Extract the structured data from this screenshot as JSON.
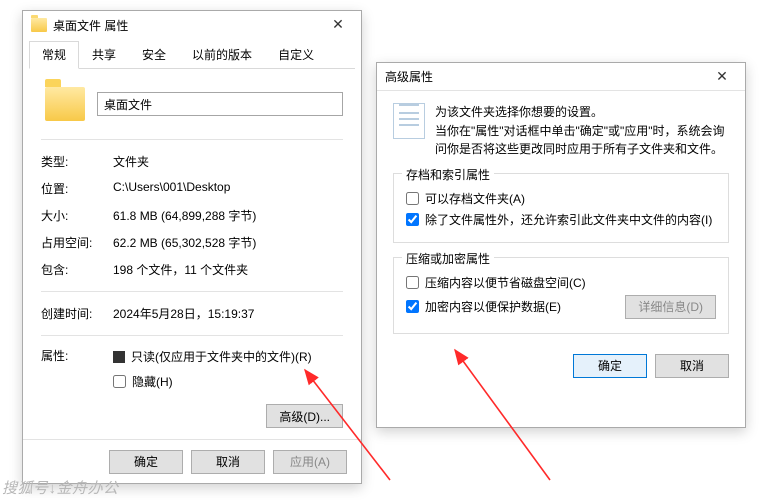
{
  "props": {
    "window_title": "桌面文件 属性",
    "tabs": [
      "常规",
      "共享",
      "安全",
      "以前的版本",
      "自定义"
    ],
    "name_value": "桌面文件",
    "type_label": "类型:",
    "type_value": "文件夹",
    "location_label": "位置:",
    "location_value": "C:\\Users\\001\\Desktop",
    "size_label": "大小:",
    "size_value": "61.8 MB (64,899,288 字节)",
    "sizeondisk_label": "占用空间:",
    "sizeondisk_value": "62.2 MB (65,302,528 字节)",
    "contains_label": "包含:",
    "contains_value": "198 个文件，11 个文件夹",
    "created_label": "创建时间:",
    "created_value": "2024年5月28日，15:19:37",
    "attr_label": "属性:",
    "readonly_label": "只读(仅应用于文件夹中的文件)(R)",
    "hidden_label": "隐藏(H)",
    "advanced_btn": "高级(D)...",
    "ok": "确定",
    "cancel": "取消",
    "apply": "应用(A)"
  },
  "adv": {
    "window_title": "高级属性",
    "intro1": "为该文件夹选择你想要的设置。",
    "intro2": "当你在\"属性\"对话框中单击\"确定\"或\"应用\"时，系统会询问你是否将这些更改同时应用于所有子文件夹和文件。",
    "group_archive": "存档和索引属性",
    "archive_label": "可以存档文件夹(A)",
    "index_label": "除了文件属性外，还允许索引此文件夹中文件的内容(I)",
    "group_encrypt": "压缩或加密属性",
    "compress_label": "压缩内容以便节省磁盘空间(C)",
    "encrypt_label": "加密内容以便保护数据(E)",
    "details_btn": "详细信息(D)",
    "ok": "确定",
    "cancel": "取消"
  },
  "watermark": "搜狐号↓金舟办公"
}
